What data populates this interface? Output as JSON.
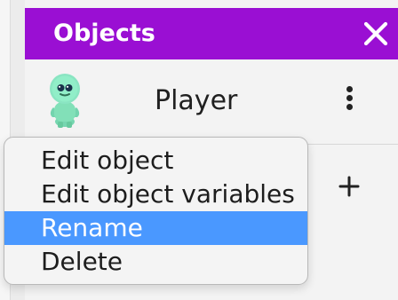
{
  "objects_panel": {
    "title": "Objects",
    "close_icon": "close-icon",
    "items": [
      {
        "label": "Player",
        "avatar_icon": "alien-avatar-icon",
        "menu_icon": "more-vertical-icon"
      }
    ],
    "add_icon": "plus-icon"
  },
  "context_menu": {
    "items": [
      {
        "label": "Edit object",
        "selected": false
      },
      {
        "label": "Edit object variables",
        "selected": false
      },
      {
        "label": "Rename",
        "selected": true
      },
      {
        "label": "Delete",
        "selected": false
      }
    ]
  },
  "colors": {
    "header": "#9a0fd3",
    "selection": "#4a98ff",
    "panel": "#f3f3f3"
  }
}
